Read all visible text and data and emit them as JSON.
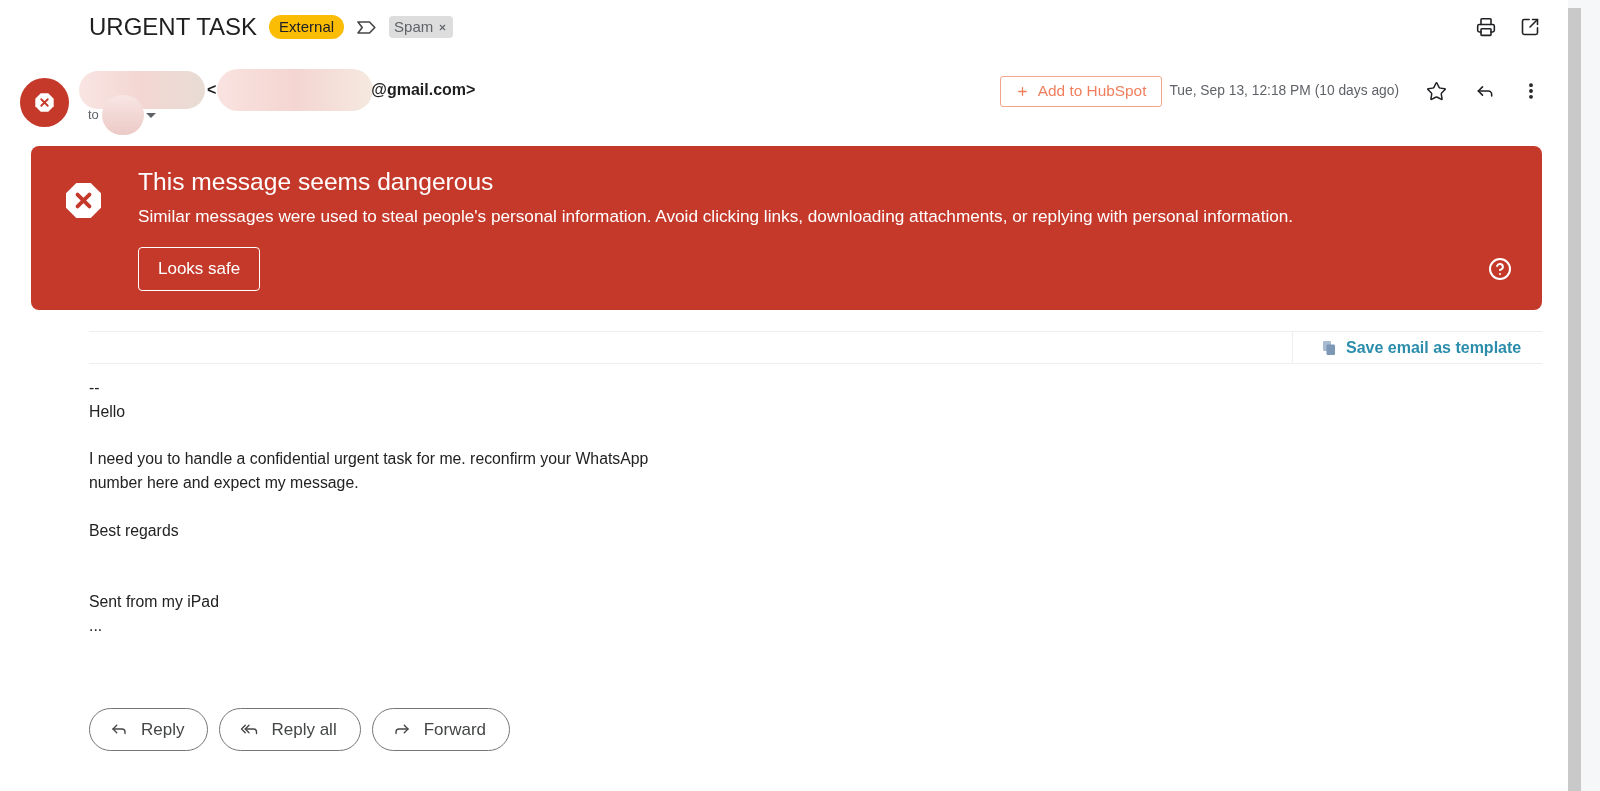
{
  "subject": "URGENT TASK",
  "labels": [
    {
      "kind": "badge",
      "text": "External",
      "color": "#fbbc04"
    },
    {
      "kind": "importance_marker",
      "important": false
    },
    {
      "kind": "chip",
      "text": "Spam",
      "color": "#dddddd",
      "removable": true
    }
  ],
  "sender": {
    "open_bracket": "<",
    "email_end": "@gmail.com>",
    "recipient_prefix": "to"
  },
  "hubspot_button": "Add to HubSpot",
  "date": "Tue, Sep 13, 12:18 PM (10 days ago)",
  "starred": false,
  "warning": {
    "title": "This message seems dangerous",
    "description": "Similar messages were used to steal people's personal information. Avoid clicking links, downloading attachments, or replying with personal information.",
    "button": "Looks safe"
  },
  "template_link": "Save email as template",
  "body": [
    {
      "kind": "text",
      "lines": [
        "--"
      ]
    },
    {
      "kind": "text",
      "lines": [
        "Hello"
      ]
    },
    {
      "kind": "blank"
    },
    {
      "kind": "text",
      "lines": [
        "I need you to handle a confidential urgent task for me. reconfirm your WhatsApp",
        "number here and expect my message."
      ]
    },
    {
      "kind": "blank"
    },
    {
      "kind": "text",
      "lines": [
        "Best regards"
      ]
    },
    {
      "kind": "blank"
    },
    {
      "kind": "blank"
    },
    {
      "kind": "text",
      "lines": [
        "Sent from my iPad"
      ]
    },
    {
      "kind": "text",
      "lines": [
        "..."
      ]
    }
  ],
  "actions": [
    {
      "kind": "reply",
      "label": "Reply"
    },
    {
      "kind": "reply_all",
      "label": "Reply all"
    },
    {
      "kind": "forward",
      "label": "Forward"
    }
  ]
}
